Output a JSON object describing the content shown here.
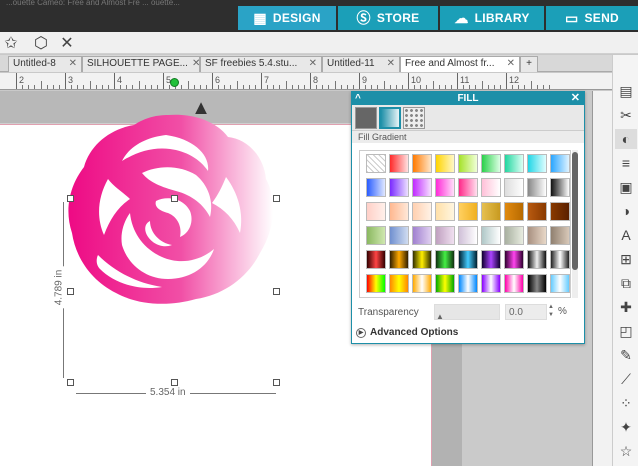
{
  "window": {
    "title_partial": "...ouette Cameo: Free and Almost Fre ... ouette..."
  },
  "nav": {
    "design": "DESIGN",
    "store": "STORE",
    "library": "LIBRARY",
    "send": "SEND"
  },
  "doc_tabs": [
    {
      "label": "Untitled-8",
      "close": "✕"
    },
    {
      "label": "SILHOUETTE PAGE...",
      "close": "✕"
    },
    {
      "label": "SF freebies 5.4.stu...",
      "close": "✕"
    },
    {
      "label": "Untitled-11",
      "close": "✕"
    },
    {
      "label": "Free and Almost fr...",
      "close": "✕"
    }
  ],
  "new_tab": "+",
  "ruler": {
    "numbers": [
      "2",
      "3",
      "4",
      "5",
      "6",
      "7",
      "8",
      "9",
      "10",
      "11",
      "12"
    ]
  },
  "selection": {
    "width_label": "5.354 in",
    "height_label": "4.789 in"
  },
  "fill_panel": {
    "title": "FILL",
    "collapse": "^",
    "close": "✕",
    "section_label": "Fill Gradient",
    "transparency_label": "Transparency",
    "transparency_value": "0.0",
    "transparency_unit": "%",
    "advanced_label": "Advanced Options",
    "swatch_rows": [
      [
        "none",
        "linear-gradient(90deg,#ff2a2a,#ffe0e0)",
        "linear-gradient(90deg,#ff7a00,#ffe6c8)",
        "linear-gradient(90deg,#ffd400,#fff8c8)",
        "linear-gradient(90deg,#a6e22a,#f0ffd8)",
        "linear-gradient(90deg,#2ad04a,#dcffe4)",
        "linear-gradient(90deg,#22d6a0,#dcfff4)",
        "linear-gradient(90deg,#22d6e6,#e0feff)",
        "linear-gradient(90deg,#2aa6ff,#e0f3ff)"
      ],
      [
        "linear-gradient(90deg,#2a5dff,#e0e8ff)",
        "linear-gradient(90deg,#7a2aff,#ece0ff)",
        "linear-gradient(90deg,#c02aff,#f6e0ff)",
        "linear-gradient(90deg,#ff2ad8,#ffe0fa)",
        "linear-gradient(90deg,#ff2a8a,#ffe0ee)",
        "linear-gradient(90deg,#ffc0d8,#ffffff)",
        "linear-gradient(90deg,#dddddd,#ffffff)",
        "linear-gradient(90deg,#888888,#ffffff)",
        "linear-gradient(90deg,#111111,#ffffff)"
      ],
      [
        "linear-gradient(90deg,#ffd0c8,#fff0ea)",
        "linear-gradient(90deg,#ffb890,#ffe8d8)",
        "linear-gradient(90deg,#ffd0b0,#fff2e6)",
        "linear-gradient(90deg,#ffe0a8,#fff6e0)",
        "linear-gradient(90deg,#ffd060,#f0b020)",
        "linear-gradient(90deg,#e6c050,#c89a20)",
        "linear-gradient(90deg,#e08a10,#b86a00)",
        "linear-gradient(90deg,#b85a10,#8a3a00)",
        "linear-gradient(90deg,#8a3a00,#5a2000)"
      ],
      [
        "linear-gradient(90deg,#8ab860,#d0e8b0)",
        "linear-gradient(90deg,#7090d0,#d0dcf0)",
        "linear-gradient(90deg,#a080d0,#e0d0f0)",
        "linear-gradient(90deg,#c0a0c0,#f0e0f0)",
        "linear-gradient(90deg,#d0c0d8,#ffffff)",
        "linear-gradient(90deg,#b0c8c8,#ffffff)",
        "linear-gradient(90deg,#a8b0a0,#e8ece0)",
        "linear-gradient(90deg,#a89080,#e8d8c8)",
        "linear-gradient(90deg,#908070,#d8c8b8)"
      ],
      [
        "linear-gradient(90deg,#300,#f44,#300)",
        "linear-gradient(90deg,#332000,#fa0,#332000)",
        "linear-gradient(90deg,#333000,#fe0,#333000)",
        "linear-gradient(90deg,#103010,#4e4,#103010)",
        "linear-gradient(90deg,#002030,#4cf,#002030)",
        "linear-gradient(90deg,#100030,#a4f,#100030)",
        "linear-gradient(90deg,#300030,#f4e,#300030)",
        "linear-gradient(90deg,#111,#eee,#111)",
        "linear-gradient(90deg,#222,#fff,#222)"
      ],
      [
        "linear-gradient(90deg,#f00,#ff0,#0f0)",
        "linear-gradient(90deg,#f80,#ff0,#f80)",
        "linear-gradient(90deg,#fa0,#fff,#fa0)",
        "linear-gradient(90deg,#0a0,#ff0,#0a0)",
        "linear-gradient(90deg,#08f,#fff,#08f)",
        "linear-gradient(90deg,#80f,#fff,#80f)",
        "linear-gradient(90deg,#f0a,#fff,#f0a)",
        "linear-gradient(90deg,#000,#888,#000)",
        "linear-gradient(90deg,#6cf,#fff,#6cf)"
      ]
    ]
  },
  "right_sidebar": [
    "page-setup",
    "cut-settings",
    "fill-color",
    "line-style",
    "fill-pattern",
    "transparency",
    "text-style",
    "align",
    "replicate",
    "modify",
    "offset",
    "trace",
    "knife",
    "point-editing",
    "image-effects",
    "star"
  ]
}
